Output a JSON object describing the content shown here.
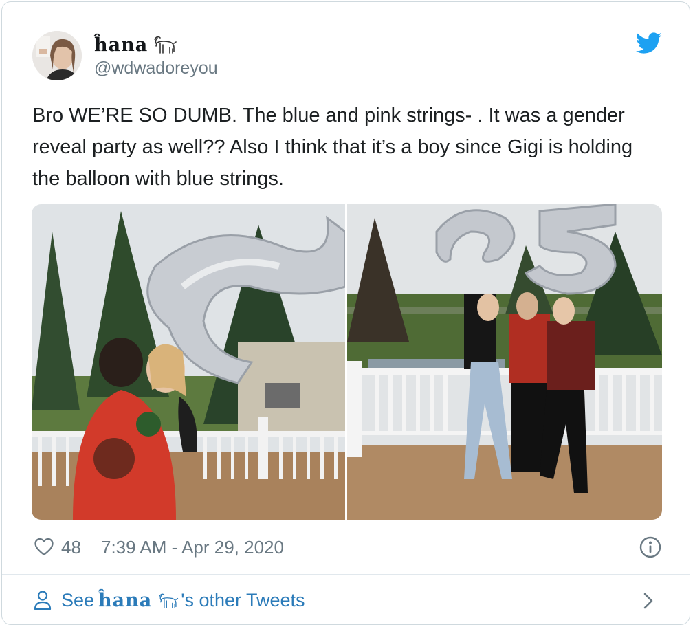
{
  "user": {
    "display_name": "ĥana",
    "handle": "@wdwadoreyou",
    "emoji": "goat-emoji"
  },
  "tweet": {
    "text": "Bro WE’RE SO DUMB. The blue and pink strings- . It was a gender reveal party as well?? Also I think that it’s a boy since Gigi is holding the balloon with blue strings."
  },
  "media": {
    "images": [
      "photo-hug-balloon",
      "photo-group-balloons"
    ]
  },
  "footer": {
    "like_count": "48",
    "timestamp": "7:39 AM - Apr 29, 2020"
  },
  "see_more": {
    "prefix": "See",
    "name": "ĥana",
    "suffix": "'s other Tweets"
  },
  "colors": {
    "twitter_blue": "#1da1f2",
    "link_blue": "#2b7bb9",
    "muted_gray": "#697882",
    "text": "#1c2022",
    "border": "#cfd9de"
  }
}
